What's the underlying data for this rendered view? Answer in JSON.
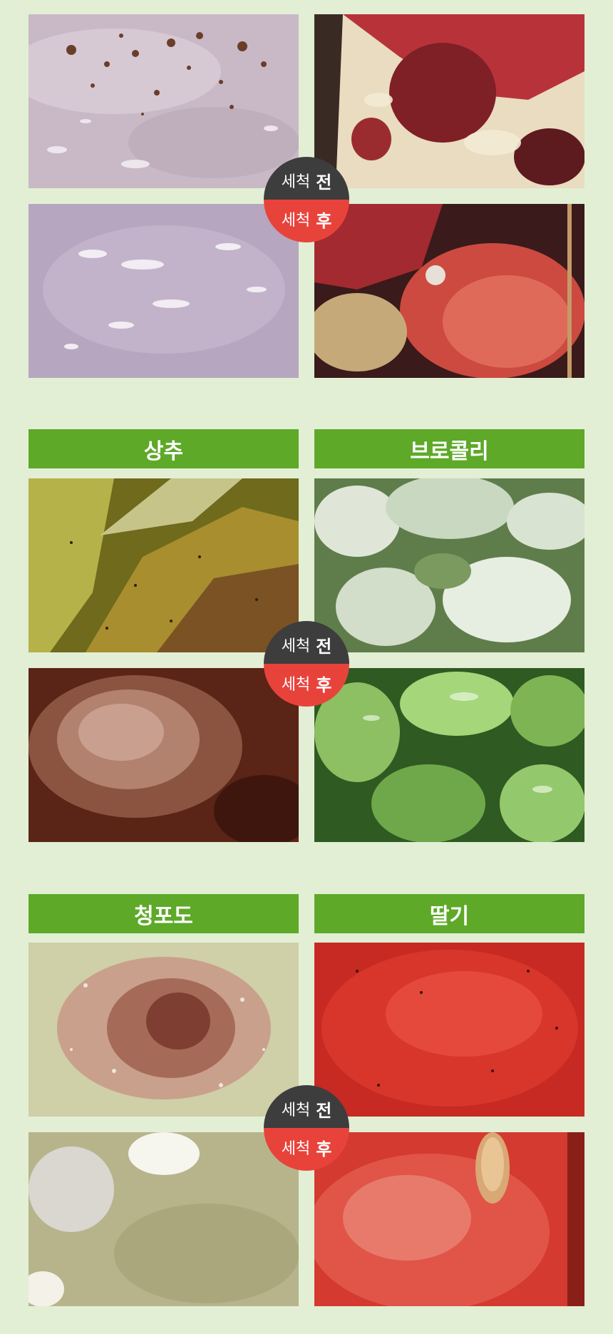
{
  "badge": {
    "wash_word": "세척",
    "before": "전",
    "after": "후"
  },
  "groups": [
    {
      "left_label": "",
      "right_label": ""
    },
    {
      "left_label": "상추",
      "right_label": "브로콜리"
    },
    {
      "left_label": "청포도",
      "right_label": "딸기"
    }
  ],
  "colors": {
    "background": "#e2efd4",
    "label_bar": "#5ea928",
    "badge_before": "#3d3d3d",
    "badge_after": "#e8433b"
  }
}
